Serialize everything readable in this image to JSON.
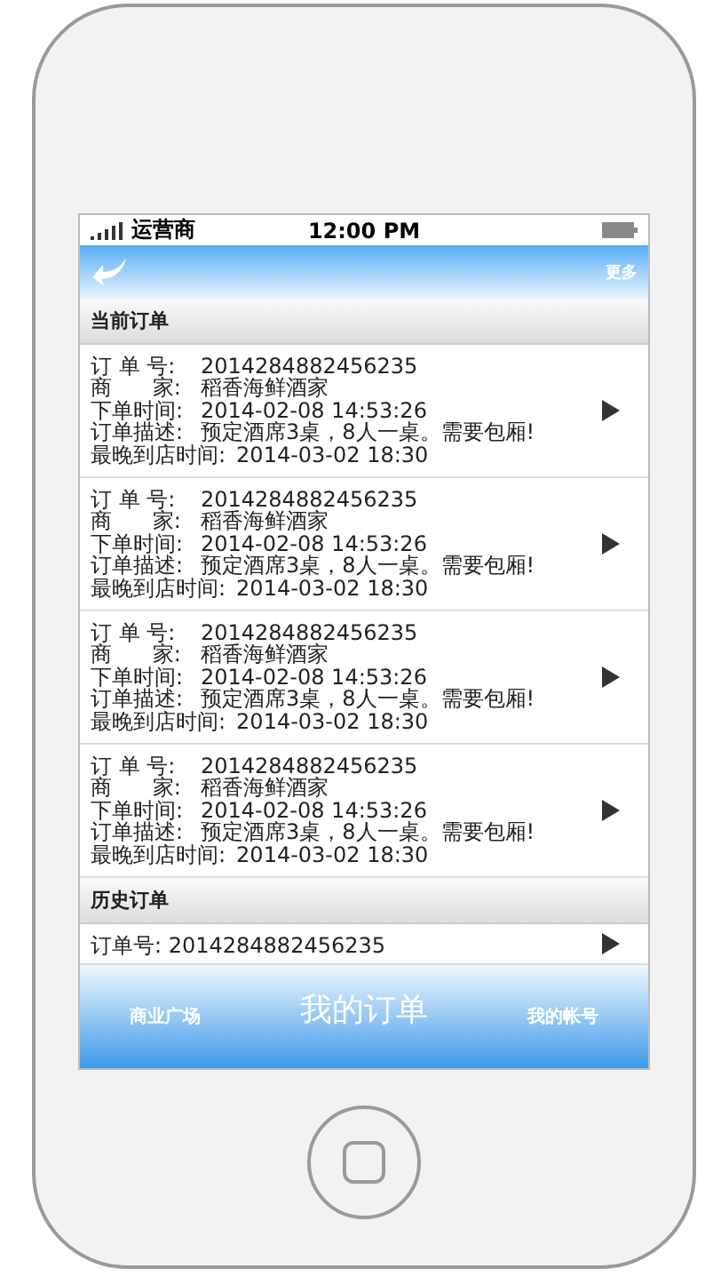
{
  "status_bar": {
    "carrier": "运营商",
    "time": "12:00 PM"
  },
  "nav_bar": {
    "right_button": "更多"
  },
  "sections": [
    {
      "title": "当前订单",
      "orders": [
        {
          "kind": "detail",
          "lines": [
            {
              "label": "订 单 号:",
              "value": "2014284882456235"
            },
            {
              "label": "商      家:",
              "value": "稻香海鲜酒家"
            },
            {
              "label": "下单时间:",
              "value": "2014-02-08 14:53:26"
            },
            {
              "label": "订单描述:",
              "value": "预定酒席3桌，8人一桌。需要包厢!"
            },
            {
              "label": "最晚到店时间:",
              "value": "2014-03-02 18:30"
            }
          ]
        },
        {
          "kind": "detail",
          "lines": [
            {
              "label": "订 单 号:",
              "value": "2014284882456235"
            },
            {
              "label": "商      家:",
              "value": "稻香海鲜酒家"
            },
            {
              "label": "下单时间:",
              "value": "2014-02-08 14:53:26"
            },
            {
              "label": "订单描述:",
              "value": "预定酒席3桌，8人一桌。需要包厢!"
            },
            {
              "label": "最晚到店时间:",
              "value": "2014-03-02 18:30"
            }
          ]
        },
        {
          "kind": "detail",
          "lines": [
            {
              "label": "订 单 号:",
              "value": "2014284882456235"
            },
            {
              "label": "商      家:",
              "value": "稻香海鲜酒家"
            },
            {
              "label": "下单时间:",
              "value": "2014-02-08 14:53:26"
            },
            {
              "label": "订单描述:",
              "value": "预定酒席3桌，8人一桌。需要包厢!"
            },
            {
              "label": "最晚到店时间:",
              "value": "2014-03-02 18:30"
            }
          ]
        },
        {
          "kind": "detail",
          "lines": [
            {
              "label": "订 单 号:",
              "value": "2014284882456235"
            },
            {
              "label": "商      家:",
              "value": "稻香海鲜酒家"
            },
            {
              "label": "下单时间:",
              "value": "2014-02-08 14:53:26"
            },
            {
              "label": "订单描述:",
              "value": "预定酒席3桌，8人一桌。需要包厢!"
            },
            {
              "label": "最晚到店时间:",
              "value": "2014-03-02 18:30"
            }
          ]
        }
      ]
    },
    {
      "title": "历史订单",
      "orders": [
        {
          "kind": "summary",
          "text": "订单号: 2014284882456235"
        }
      ]
    }
  ],
  "tab_bar": [
    {
      "label": "商业广场",
      "selected": false
    },
    {
      "label": "我的订单",
      "selected": true
    },
    {
      "label": "我的帐号",
      "selected": false
    }
  ]
}
